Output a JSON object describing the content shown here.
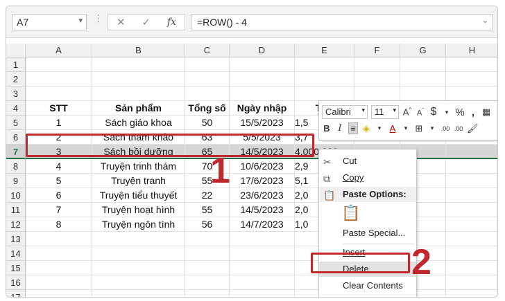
{
  "formula_bar": {
    "name_box": "A7",
    "formula": "=ROW() - 4"
  },
  "columns": [
    "A",
    "B",
    "C",
    "D",
    "E",
    "F",
    "G",
    "H"
  ],
  "rows": [
    "1",
    "2",
    "3",
    "4",
    "5",
    "6",
    "7",
    "8",
    "9",
    "10",
    "11",
    "12",
    "13",
    "14",
    "15",
    "16",
    "17"
  ],
  "table": {
    "headers": [
      "STT",
      "Sản phẩm",
      "Tổng số",
      "Ngày nhập",
      "Thà"
    ],
    "rows": [
      [
        "1",
        "Sách giáo khoa",
        "50",
        "15/5/2023",
        "1,5"
      ],
      [
        "2",
        "Sách tham khảo",
        "63",
        "5/5/2023",
        "3,7"
      ],
      [
        "3",
        "Sách bồi dưỡng",
        "65",
        "14/5/2023",
        "4,000,000"
      ],
      [
        "4",
        "Truyện trinh thám",
        "70",
        "10/6/2023",
        "2,9"
      ],
      [
        "5",
        "Truyện tranh",
        "55",
        "17/6/2023",
        "5,1"
      ],
      [
        "6",
        "Truyện tiểu thuyết",
        "22",
        "23/6/2023",
        "2,0"
      ],
      [
        "7",
        "Truyện hoạt hình",
        "55",
        "14/5/2023",
        "2,0"
      ],
      [
        "8",
        "Truyện ngôn tình",
        "56",
        "14/7/2023",
        "1,0"
      ]
    ]
  },
  "mini_toolbar": {
    "font": "Calibri",
    "size": "11",
    "grow": "A",
    "shrink": "A",
    "currency": "$",
    "percent": "%",
    "comma": ",",
    "bold": "B",
    "italic": "I",
    "font_color": "A",
    "inc_decimal": ".00",
    "dec_decimal": ".00"
  },
  "context_menu": {
    "cut": "Cut",
    "copy": "Copy",
    "paste_options": "Paste Options:",
    "paste_special": "Paste Special...",
    "insert": "Insert",
    "delete": "Delete",
    "clear_contents": "Clear Contents"
  },
  "annotations": {
    "step1": "1",
    "step2": "2"
  },
  "colors": {
    "accent_red": "#c0282d",
    "excel_green": "#217346"
  }
}
